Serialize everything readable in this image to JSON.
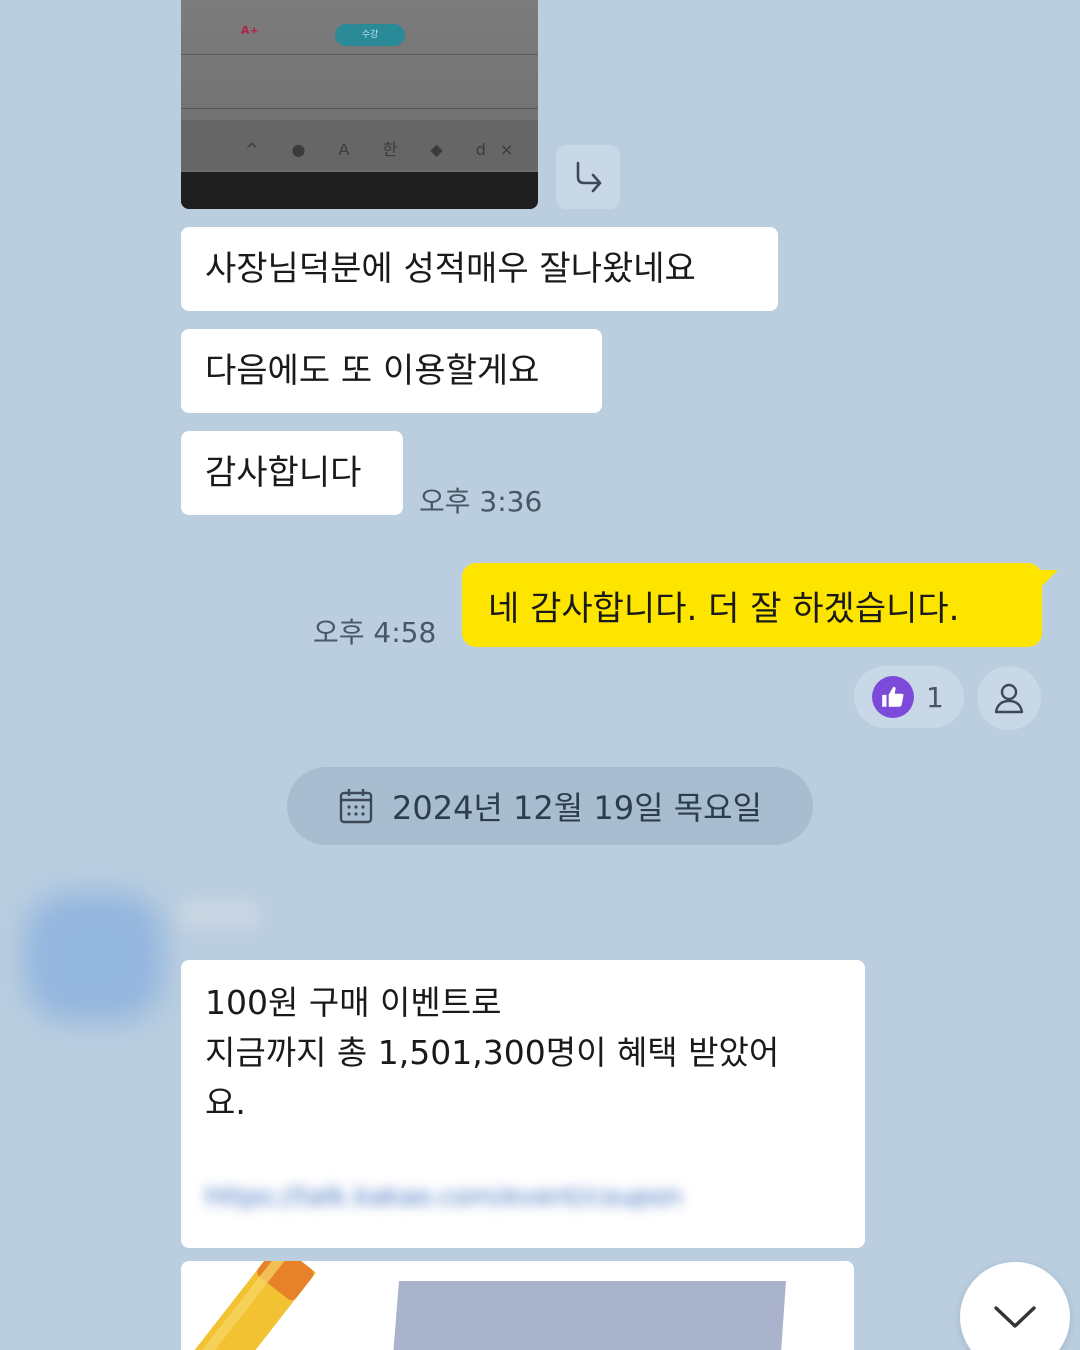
{
  "photo": {
    "grade_text": "A+",
    "pill_text": "수강",
    "tray_text": "^ ● A 한 ◆ d× ●"
  },
  "messages": {
    "received": [
      {
        "text": "사장님덕분에 성적매우 잘나왔네요"
      },
      {
        "text": "다음에도 또 이용할게요"
      },
      {
        "text": "감사합니다"
      }
    ],
    "received_time": "오후 3:36",
    "sent": {
      "text": "네 감사합니다. 더 잘 하겠습니다.",
      "time": "오후 4:58",
      "reaction_count": "1"
    }
  },
  "date_separator": "2024년 12월 19일 목요일",
  "event": {
    "line1": "100원 구매 이벤트로",
    "line2": "지금까지 총 1,501,300명이 혜택 받았어",
    "line3": "요.",
    "link": "https://talk.kakao.com/event/coupon"
  },
  "colors": {
    "background": "#bacee0",
    "sent_bubble": "#fee500",
    "received_bubble": "#ffffff",
    "reaction_accent": "#7b4ad8"
  },
  "icons": {
    "share": "share-arrow-icon",
    "thumbs_up": "thumbs-up-icon",
    "person": "person-icon",
    "calendar": "calendar-icon",
    "scroll_down": "chevron-down-icon"
  }
}
